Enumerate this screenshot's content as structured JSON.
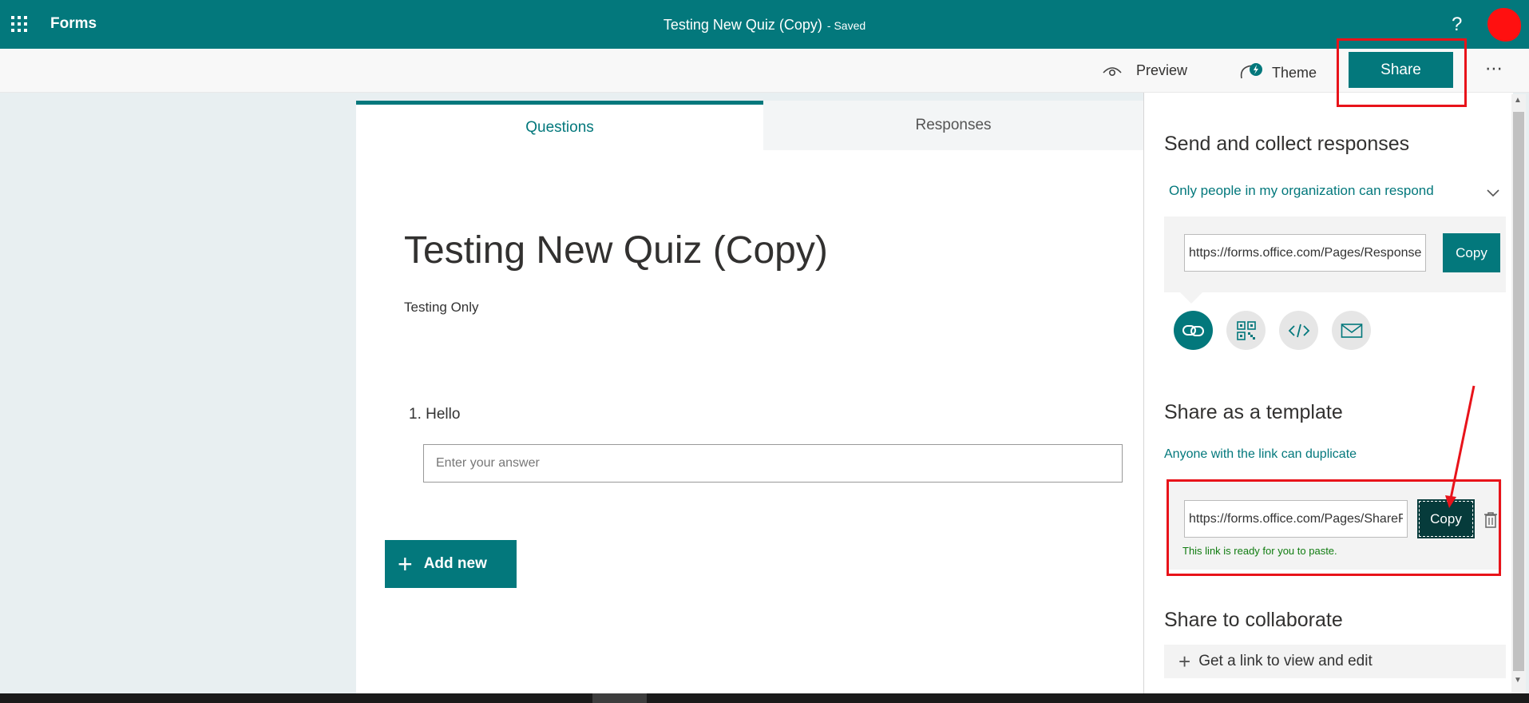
{
  "topbar": {
    "app_name": "Forms",
    "doc_title": "Testing New Quiz (Copy)",
    "saved_status": "- Saved",
    "help_label": "?"
  },
  "commandbar": {
    "preview_label": "Preview",
    "theme_label": "Theme",
    "share_label": "Share",
    "more_label": "⋯"
  },
  "tabs": {
    "questions": "Questions",
    "responses": "Responses"
  },
  "form": {
    "title": "Testing New Quiz (Copy)",
    "description": "Testing Only",
    "question_number": "1.",
    "question_text": "Hello",
    "answer_placeholder": "Enter your answer",
    "add_new_label": "Add new",
    "add_new_icon": "+"
  },
  "share_panel": {
    "send_heading": "Send and collect responses",
    "audience_option": "Only people in my organization can respond",
    "response_url": "https://forms.office.com/Pages/ResponsePage.aspx",
    "copy_label": "Copy",
    "icons": [
      "link-icon",
      "qr-code-icon",
      "embed-icon",
      "email-icon"
    ],
    "template_heading": "Share as a template",
    "template_sub": "Anyone with the link can duplicate",
    "template_url": "https://forms.office.com/Pages/ShareFormPage.aspx",
    "template_copy_label": "Copy",
    "ready_message": "This link is ready for you to paste.",
    "collab_heading": "Share to collaborate",
    "collab_link_label": "Get a link to view and edit",
    "collab_plus": "+"
  },
  "colors": {
    "brand": "#03787c",
    "annotation": "#e8131a",
    "success": "#107c10"
  }
}
